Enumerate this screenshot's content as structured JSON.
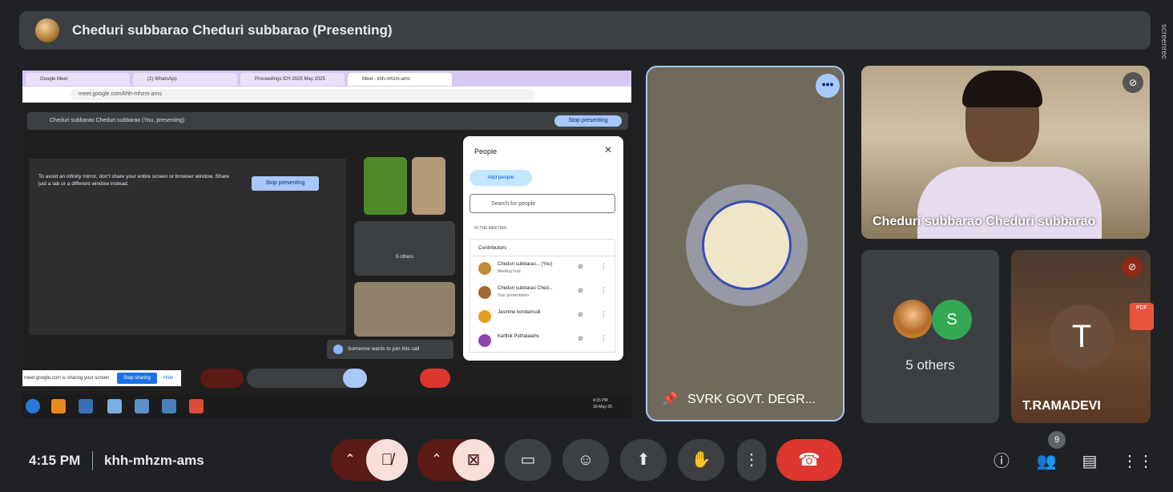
{
  "presenter_bar": {
    "title": "Cheduri subbarao Cheduri subbarao (Presenting)"
  },
  "recorder_watermark": "screenrec",
  "shared_screen": {
    "browser_tabs": [
      "Google Meet",
      "(2) WhatsApp",
      "Proceedings IDY-2025 May 2025",
      "Meet - khh-mhzm-ams"
    ],
    "url": "meet.google.com/khh-mhzm-ams",
    "inner_bar_text": "Cheduri subbarao Cheduri subbarao (You, presenting)",
    "inner_stop_label": "Stop presenting",
    "mirror_warning": "To avoid an infinity mirror, don't share your entire screen or browser window. Share just a tab or a different window instead.",
    "mirror_stop_label": "Stop presenting",
    "mini_tile_others": "5 others",
    "people_panel": {
      "title": "People",
      "add_people": "Add people",
      "search_placeholder": "Search for people",
      "section_label": "IN THE MEETING",
      "contributors_label": "Contributors",
      "rows": [
        {
          "name": "Cheduri subbarao... (You)",
          "sub": "Meeting host"
        },
        {
          "name": "Cheduri subbarao Ched...",
          "sub": "Your presentation"
        },
        {
          "name": "Jasmine kondamudi",
          "sub": ""
        },
        {
          "name": "Karthik Pothalaiahs",
          "sub": ""
        }
      ]
    },
    "toast": "Someone wants to join this call",
    "share_notice": "meet.google.com is sharing your screen.",
    "share_stop": "Stop sharing",
    "share_hide": "Hide",
    "taskbar_clock": "4:15 PM\n30-May-25"
  },
  "tiles": {
    "svrk": {
      "label": "SVRK GOVT. DEGR...",
      "more": "•••"
    },
    "cheduri": {
      "label": "Cheduri subbarao Cheduri subbarao"
    },
    "others": {
      "label": "5 others",
      "initial": "S"
    },
    "ramadevi": {
      "label": "T.RAMADEVI",
      "initial": "T"
    },
    "pdf_label": "PDF"
  },
  "bottom": {
    "time": "4:15 PM",
    "meeting_code": "khh-mhzm-ams",
    "people_count": "9"
  },
  "colors": {
    "end_call": "#dc362e",
    "muted_bg": "#f9dedc",
    "accent": "#a8c7fa"
  }
}
